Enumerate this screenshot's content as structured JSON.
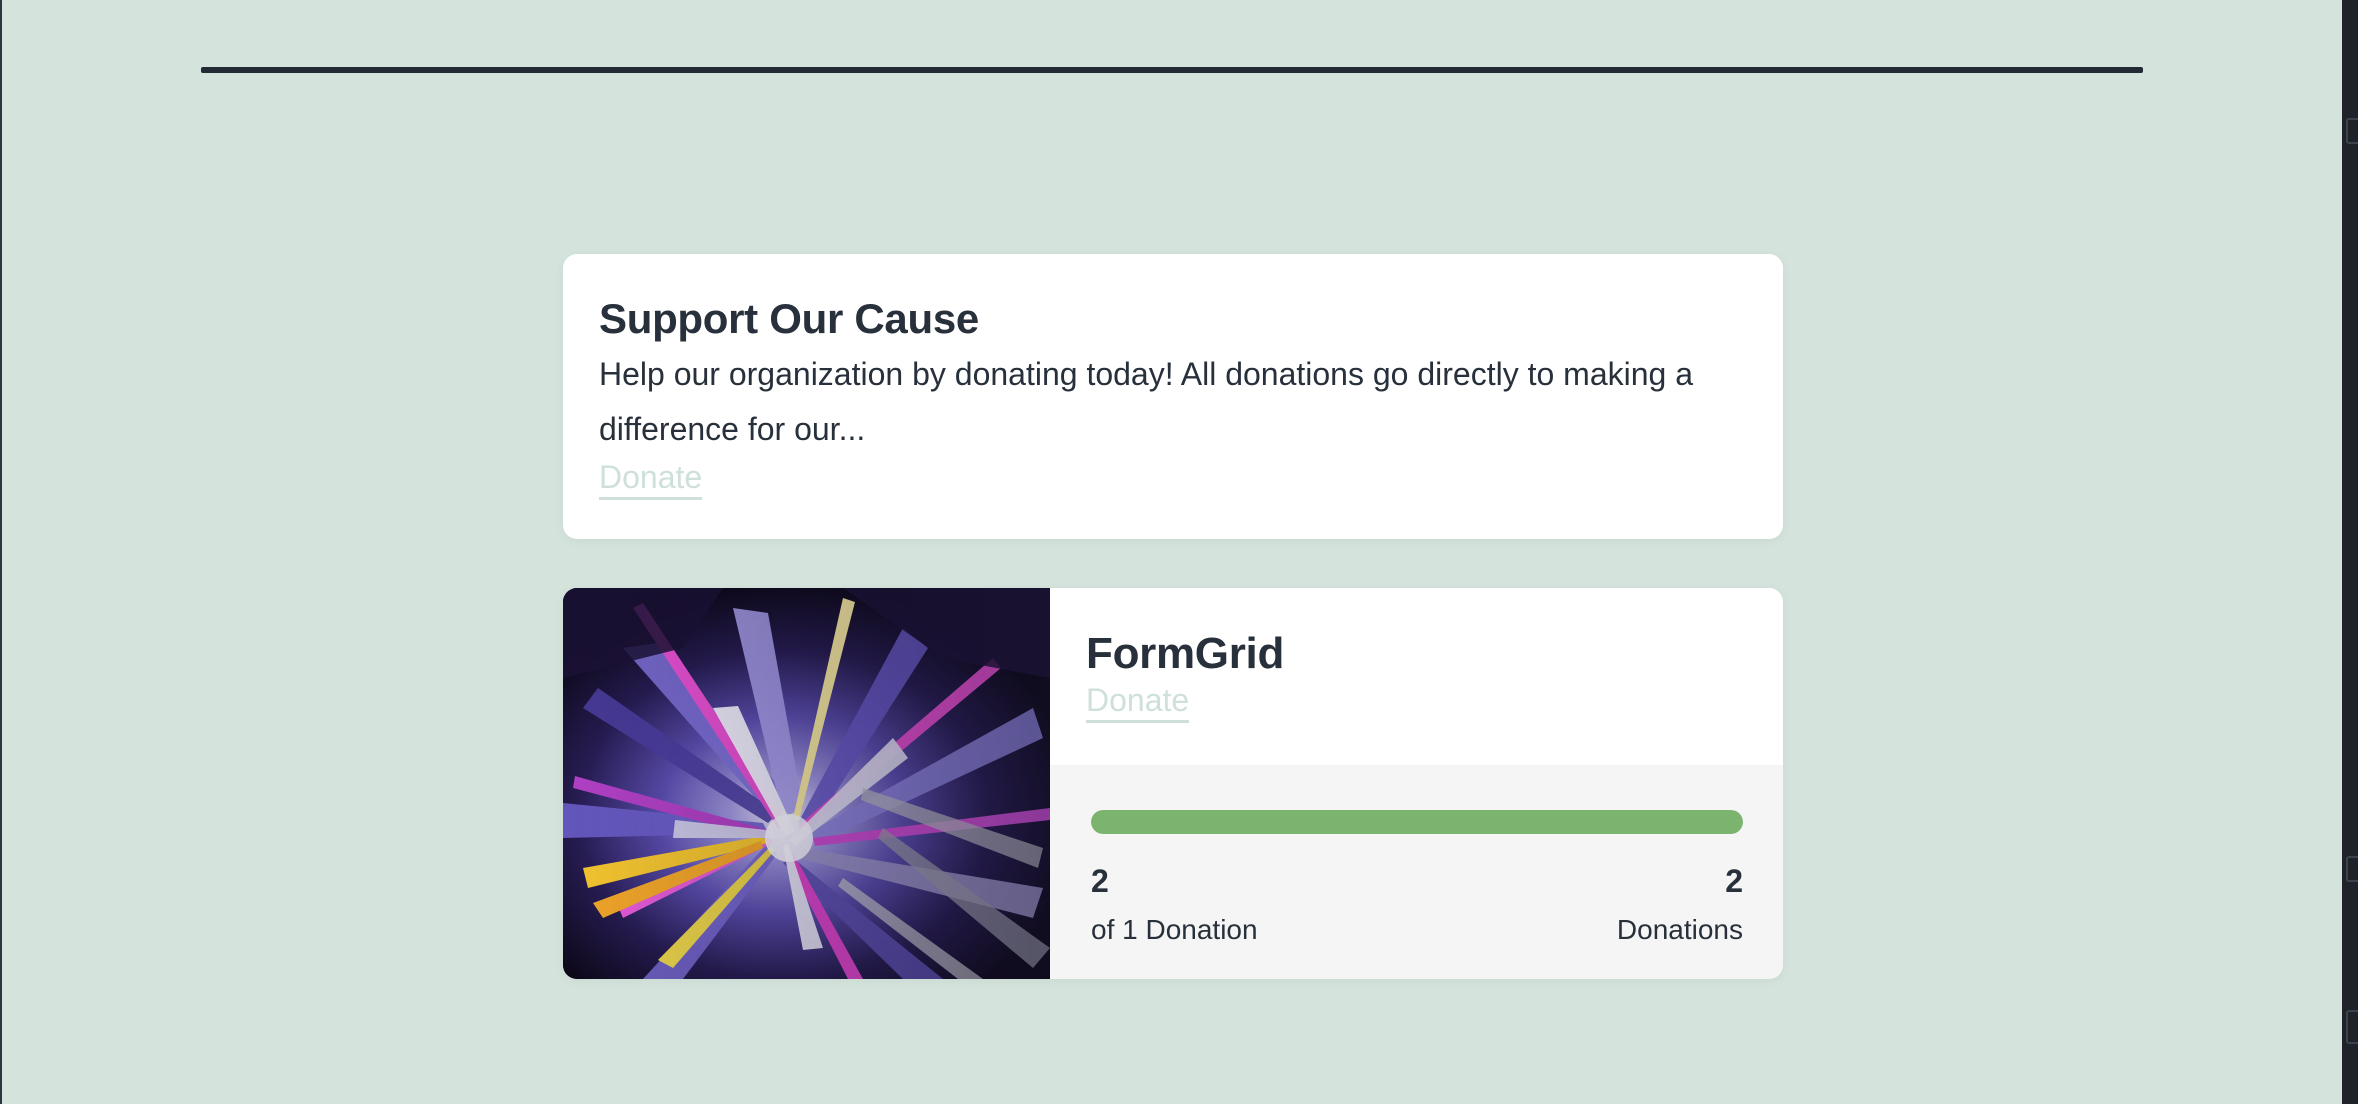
{
  "cause_card": {
    "title": "Support Our Cause",
    "description": "Help our organization by donating today! All donations go directly to making a difference for our...",
    "donate_label": "Donate"
  },
  "campaign_card": {
    "title": "FormGrid",
    "donate_label": "Donate",
    "image_desc": "abstract-purple-explosion-art",
    "progress": {
      "fraction": 1.0,
      "fill_color": "#7ab46e"
    },
    "stats": {
      "raised_value": "2",
      "raised_label": "of 1 Donation",
      "count_value": "2",
      "count_label": "Donations"
    }
  },
  "colors": {
    "background": "#d4e4dc",
    "text": "#28303b",
    "link": "#cfe0da",
    "rule": "#232a33"
  }
}
